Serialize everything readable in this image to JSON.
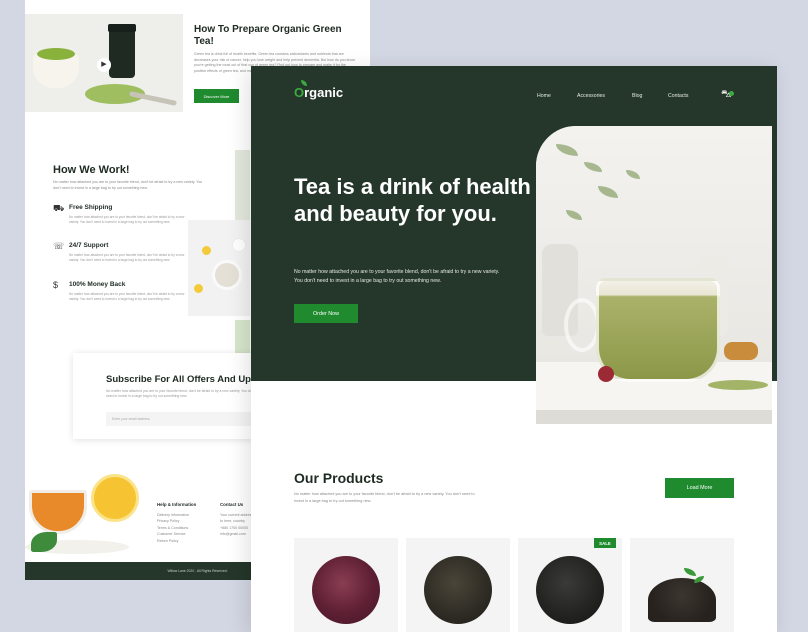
{
  "back_page": {
    "prepare": {
      "title": "How To Prepare Organic Green Tea!",
      "text": "Green tea is drink full of health benefits. Green tea contains antioxidants and nutrients that are decreases your risk of cancer, help you lose weight and help prevent dementia. But how do you know you're getting the most out of that cup of green tea? Find out how to prepare and make it for the positive effects of green tea, and make delicious",
      "button": "Discover More"
    },
    "how_we_work": {
      "title": "How  We Work!",
      "text": "No matter how attached you are to your favorite blend, don't be afraid to try a new variety. You don't need to invest in a large bag to try out something new.",
      "features": [
        {
          "icon": "truck-icon",
          "title": "Free Shipping",
          "text": "No matter how attached you are to your favorite blend, don't be afraid to try a new variety. You don't need to invest in a large bag to try out something new."
        },
        {
          "icon": "support-icon",
          "title": "24/7 Support",
          "text": "No matter how attached you are to your favorite blend, don't be afraid to try a new variety. You don't need to invest in a large bag to try out something new."
        },
        {
          "icon": "money-back-icon",
          "title": "100% Money Back",
          "text": "No matter how attached you are to your favorite blend, don't be afraid to try a new variety. You don't need to invest in a large bag to try out something new."
        }
      ]
    },
    "subscribe": {
      "title": "Subscribe For All Offers And Updates",
      "text": "No matter how attached you are to your favorite blend, don't be afraid to try a new variety. You don't need to invest in a large bag to try out something new.",
      "placeholder": "Enter your email address"
    },
    "footer": {
      "help": {
        "heading": "Help & Information",
        "links": [
          "Delivery Information",
          "Privacy Policy",
          "Terms & Conditions",
          "Customer Service",
          "Return Policy"
        ]
      },
      "contact": {
        "heading": "Contact Us",
        "lines": [
          "Your current address goes",
          "to here, country",
          "+880 1700 00000",
          "info@gmail.com"
        ]
      },
      "copyright": "Willow Lane 2020 , All Rights Reserved."
    }
  },
  "front_page": {
    "logo": {
      "first_letter": "O",
      "rest": "rganic"
    },
    "nav": [
      "Home",
      "Accessories",
      "Blog",
      "Contacts"
    ],
    "hero": {
      "headline": "Tea is a drink of health and beauty for you.",
      "text": "No matter how attached you are to your favorite blend, don't be afraid to try a new variety. You don't need to invest in a large bag to try out something new.",
      "button": "Order Now"
    },
    "products": {
      "title": "Our Products",
      "text": "No matter how attached you are to your favorite blend, don't be afraid to try a new variety. You don't need to invest in a large bag to try out something new.",
      "button": "Load More",
      "sale_badge": "SALE"
    }
  },
  "colors": {
    "hero_bg": "#25362a",
    "accent_green": "#1f8a2e",
    "page_bg": "#d3d6e3"
  }
}
